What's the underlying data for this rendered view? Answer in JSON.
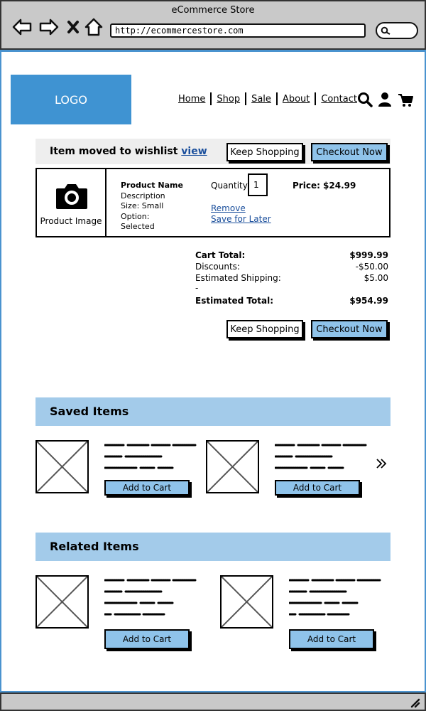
{
  "window": {
    "title": "eCommerce Store",
    "url": "http://ecommercestore.com"
  },
  "header": {
    "logo": "LOGO",
    "nav": [
      "Home",
      "Shop",
      "Sale",
      "About",
      "Contact"
    ]
  },
  "notice": {
    "text": "Item moved to wishlist",
    "link": "view",
    "keep_shopping": "Keep Shopping",
    "checkout": "Checkout Now"
  },
  "product": {
    "image_label": "Product Image",
    "name": "Product Name",
    "description": "Description",
    "size": "Size: Small",
    "option_line1": "Option:",
    "option_line2": "Selected",
    "quantity_label": "Quantity",
    "quantity": "1",
    "price": "Price: $24.99",
    "remove": "Remove",
    "save_for_later": "Save for Later"
  },
  "totals": {
    "cart_total_label": "Cart Total:",
    "cart_total": "$999.99",
    "discounts_label": "Discounts:",
    "discounts": "-$50.00",
    "shipping_label": "Estimated Shipping:",
    "shipping": "$5.00",
    "dash": "-",
    "estimated_total_label": "Estimated Total:",
    "estimated_total": "$954.99",
    "keep_shopping": "Keep Shopping",
    "checkout": "Checkout Now"
  },
  "saved": {
    "title": "Saved Items",
    "add_to_cart": "Add to Cart"
  },
  "related": {
    "title": "Related Items",
    "add_to_cart": "Add to Cart"
  },
  "colors": {
    "accent": "#3f93d2",
    "section_bg": "#a3cbea",
    "button_blue": "#8fc3ea",
    "link": "#1b4f9c"
  }
}
